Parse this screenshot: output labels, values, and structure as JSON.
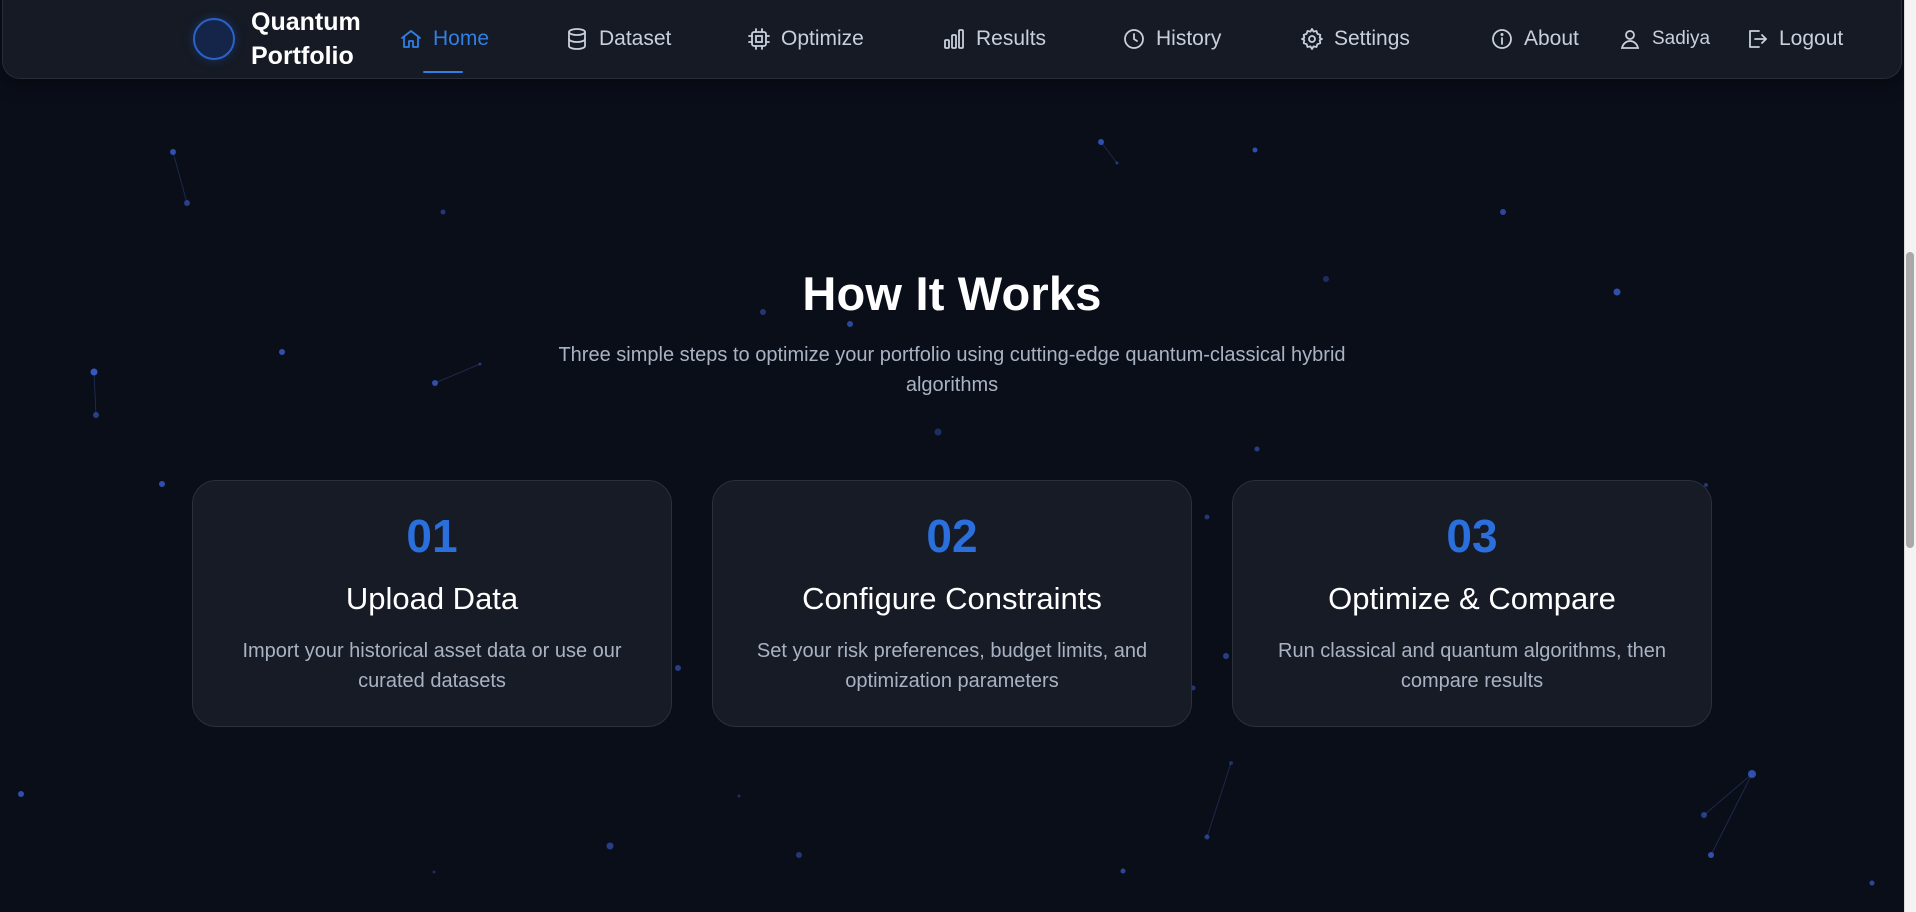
{
  "brand": {
    "name": "Quantum Portfolio"
  },
  "nav": {
    "items": [
      {
        "label": "Home",
        "icon": "home-icon",
        "active": true
      },
      {
        "label": "Dataset",
        "icon": "database-icon"
      },
      {
        "label": "Optimize",
        "icon": "cpu-chip-icon"
      },
      {
        "label": "Results",
        "icon": "bar-chart-icon"
      },
      {
        "label": "History",
        "icon": "clock-icon"
      },
      {
        "label": "Settings",
        "icon": "gear-icon"
      },
      {
        "label": "About",
        "icon": "info-icon"
      }
    ],
    "user": {
      "name": "Sadiya",
      "icon": "user-icon"
    },
    "logout": {
      "label": "Logout",
      "icon": "logout-icon"
    }
  },
  "section": {
    "title": "How It Works",
    "subtitle": "Three simple steps to optimize your portfolio using cutting-edge quantum-classical hybrid algorithms",
    "steps": [
      {
        "number": "01",
        "title": "Upload Data",
        "description": "Import your historical asset data or use our curated datasets"
      },
      {
        "number": "02",
        "title": "Configure Constraints",
        "description": "Set your risk preferences, budget limits, and optimization parameters"
      },
      {
        "number": "03",
        "title": "Optimize & Compare",
        "description": "Run classical and quantum algorithms, then compare results"
      }
    ]
  },
  "colors": {
    "background": "#0a0e19",
    "navbar": "#151a24",
    "card": "#161b26",
    "accent": "#2f7fe6",
    "step_number": "#2a6fdb",
    "text_muted": "#aab3c3"
  }
}
